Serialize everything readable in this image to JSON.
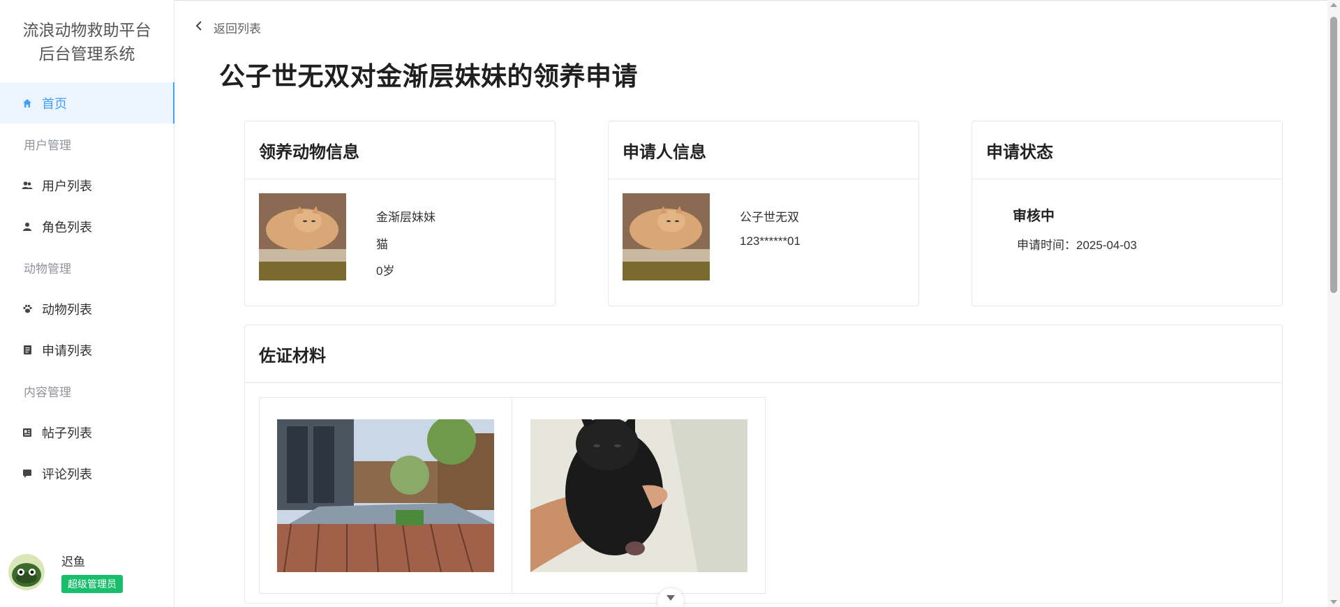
{
  "sidebar": {
    "brand_line1": "流浪动物救助平台",
    "brand_line2": "后台管理系统",
    "items": [
      {
        "label": "首页",
        "icon": "home-icon",
        "active": true
      },
      {
        "group": "用户管理"
      },
      {
        "label": "用户列表",
        "icon": "users-icon"
      },
      {
        "label": "角色列表",
        "icon": "person-icon"
      },
      {
        "group": "动物管理"
      },
      {
        "label": "动物列表",
        "icon": "paw-icon"
      },
      {
        "label": "申请列表",
        "icon": "notebook-icon"
      },
      {
        "group": "内容管理"
      },
      {
        "label": "帖子列表",
        "icon": "article-icon"
      },
      {
        "label": "评论列表",
        "icon": "comment-icon"
      }
    ],
    "user": {
      "name": "迟鱼",
      "role": "超级管理员"
    }
  },
  "main": {
    "back_label": "返回列表",
    "title": "公子世无双对金渐层妹妹的领养申请",
    "animal_card": {
      "title": "领养动物信息",
      "name": "金渐层妹妹",
      "species": "猫",
      "age": "0岁"
    },
    "applicant_card": {
      "title": "申请人信息",
      "name": "公子世无双",
      "phone": "123******01"
    },
    "status_card": {
      "title": "申请状态",
      "status": "审核中",
      "time_label": "申请时间：",
      "time_value": "2025-04-03"
    },
    "evidence_card": {
      "title": "佐证材料"
    }
  },
  "colors": {
    "accent": "#409eff",
    "badge": "#19be6b",
    "active_bg": "#ecf5ff"
  }
}
